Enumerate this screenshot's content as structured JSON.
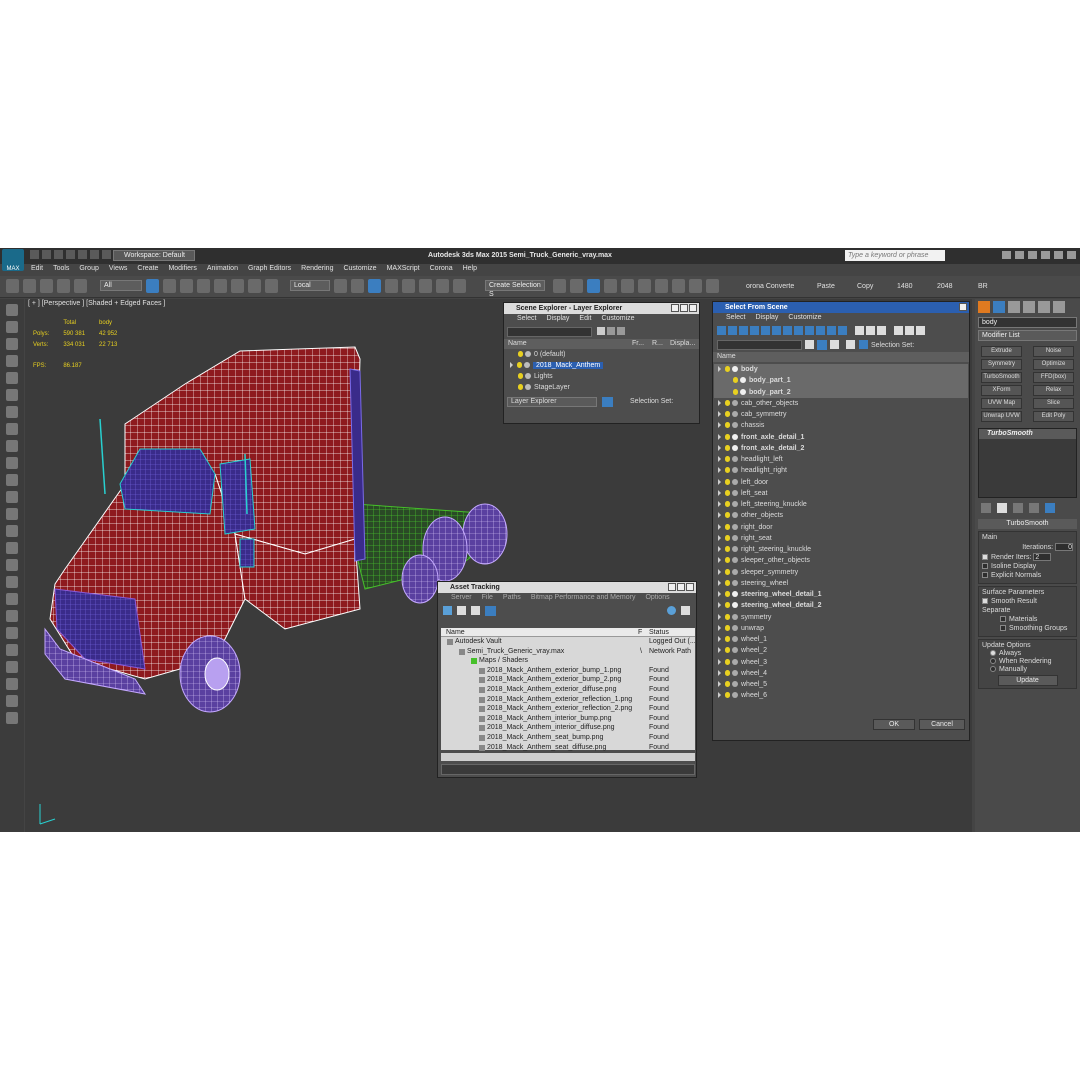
{
  "window": {
    "logo": "MAX",
    "title": "Autodesk 3ds Max  2015    Semi_Truck_Generic_vray.max",
    "workspace": "Workspace: Default",
    "search_placeholder": "Type a keyword or phrase"
  },
  "menu": [
    "Edit",
    "Tools",
    "Group",
    "Views",
    "Create",
    "Modifiers",
    "Animation",
    "Graph Editors",
    "Rendering",
    "Customize",
    "MAXScript",
    "Corona",
    "Help"
  ],
  "toolbar": {
    "filter_value": "All",
    "coord_value": "Local",
    "selection_set": "Create Selection S",
    "corona": "orona Converte",
    "paste": "Paste",
    "copy": "Copy",
    "width": "1480",
    "height": "2048",
    "br": "BR"
  },
  "viewport": {
    "label": "[ + ] [Perspective ] [Shaded + Edged Faces ]",
    "stats": {
      "col_total": "Total",
      "col_body": "body",
      "polys_label": "Polys:",
      "polys_total": "590 381",
      "polys_body": "42 952",
      "verts_label": "Verts:",
      "verts_total": "334 031",
      "verts_body": "22 713",
      "fps_label": "FPS:",
      "fps_value": "86.187"
    }
  },
  "scene_explorer": {
    "title": "Scene Explorer - Layer Explorer",
    "menu": [
      "Select",
      "Display",
      "Edit",
      "Customize"
    ],
    "columns": [
      "Name",
      "Fr...",
      "R...",
      "Displa..."
    ],
    "layers": [
      "0 (default)",
      "2018_Mack_Anthem",
      "Lights",
      "StageLayer"
    ],
    "footer_dropdown": "Layer Explorer",
    "footer_selset": "Selection Set:"
  },
  "asset_tracking": {
    "title": "Asset Tracking",
    "menu": [
      "Server",
      "File",
      "Paths",
      "Bitmap Performance and Memory",
      "Options"
    ],
    "columns": [
      "Name",
      "F",
      "Status"
    ],
    "rows": [
      {
        "name": "Autodesk Vault",
        "flag": "",
        "status": "Logged Out (..."
      },
      {
        "name": "Semi_Truck_Generic_vray.max",
        "flag": "\\",
        "status": "Network Path"
      },
      {
        "name": "Maps / Shaders",
        "flag": "",
        "status": ""
      },
      {
        "name": "2018_Mack_Anthem_exterior_bump_1.png",
        "flag": "",
        "status": "Found"
      },
      {
        "name": "2018_Mack_Anthem_exterior_bump_2.png",
        "flag": "",
        "status": "Found"
      },
      {
        "name": "2018_Mack_Anthem_exterior_diffuse.png",
        "flag": "",
        "status": "Found"
      },
      {
        "name": "2018_Mack_Anthem_exterior_reflection_1.png",
        "flag": "",
        "status": "Found"
      },
      {
        "name": "2018_Mack_Anthem_exterior_reflection_2.png",
        "flag": "",
        "status": "Found"
      },
      {
        "name": "2018_Mack_Anthem_interior_bump.png",
        "flag": "",
        "status": "Found"
      },
      {
        "name": "2018_Mack_Anthem_interior_diffuse.png",
        "flag": "",
        "status": "Found"
      },
      {
        "name": "2018_Mack_Anthem_seat_bump.png",
        "flag": "",
        "status": "Found"
      },
      {
        "name": "2018_Mack_Anthem_seat_diffuse.png",
        "flag": "",
        "status": "Found"
      }
    ]
  },
  "select_from_scene": {
    "title": "Select From Scene",
    "menu": [
      "Select",
      "Display",
      "Customize"
    ],
    "selset": "Selection Set:",
    "column": "Name",
    "items": [
      {
        "name": "body",
        "bold": true
      },
      {
        "name": "body_part_1",
        "bold": true
      },
      {
        "name": "body_part_2",
        "bold": true
      },
      {
        "name": "cab_other_objects",
        "bold": false
      },
      {
        "name": "cab_symmetry",
        "bold": false
      },
      {
        "name": "chassis",
        "bold": false
      },
      {
        "name": "front_axle_detail_1",
        "bold": true
      },
      {
        "name": "front_axle_detail_2",
        "bold": true
      },
      {
        "name": "headlight_left",
        "bold": false
      },
      {
        "name": "headlight_right",
        "bold": false
      },
      {
        "name": "left_door",
        "bold": false
      },
      {
        "name": "left_seat",
        "bold": false
      },
      {
        "name": "left_steering_knuckle",
        "bold": false
      },
      {
        "name": "other_objects",
        "bold": false
      },
      {
        "name": "right_door",
        "bold": false
      },
      {
        "name": "right_seat",
        "bold": false
      },
      {
        "name": "right_steering_knuckle",
        "bold": false
      },
      {
        "name": "sleeper_other_objects",
        "bold": false
      },
      {
        "name": "sleeper_symmetry",
        "bold": false
      },
      {
        "name": "steering_wheel",
        "bold": false
      },
      {
        "name": "steering_wheel_detail_1",
        "bold": true
      },
      {
        "name": "steering_wheel_detail_2",
        "bold": true
      },
      {
        "name": "symmetry",
        "bold": false
      },
      {
        "name": "unwrap",
        "bold": false
      },
      {
        "name": "wheel_1",
        "bold": false
      },
      {
        "name": "wheel_2",
        "bold": false
      },
      {
        "name": "wheel_3",
        "bold": false
      },
      {
        "name": "wheel_4",
        "bold": false
      },
      {
        "name": "wheel_5",
        "bold": false
      },
      {
        "name": "wheel_6",
        "bold": false
      }
    ],
    "ok": "OK",
    "cancel": "Cancel"
  },
  "command_panel": {
    "object_name": "body",
    "modifier_list": "Modifier List",
    "modifier_buttons": [
      "Extrude",
      "Noise",
      "Symmetry",
      "Optimize",
      "TurboSmooth",
      "FFD(box)",
      "XForm",
      "Relax",
      "UVW Map",
      "Slice",
      "Unwrap UVW",
      "Edit Poly"
    ],
    "stack_item": "TurboSmooth",
    "rollout_title": "TurboSmooth",
    "main_label": "Main",
    "iterations_label": "Iterations:",
    "iterations_value": "0",
    "render_iters_label": "Render Iters:",
    "render_iters_value": "2",
    "isoline": "Isoline Display",
    "explicit": "Explicit Normals",
    "surface_params": "Surface Parameters",
    "smooth_result": "Smooth Result",
    "separate": "Separate",
    "materials": "Materials",
    "smoothing_groups": "Smoothing Groups",
    "update_options": "Update Options",
    "always": "Always",
    "when_rendering": "When Rendering",
    "manually": "Manually",
    "update": "Update"
  },
  "colors": {
    "body_red": "#8e1a1e",
    "wire_white": "#ffffff",
    "chassis_green": "#46c02a",
    "wheel_purple": "#8c5ad8",
    "cyan": "#28d0d0",
    "selection_blue": "#2b5fb0"
  }
}
